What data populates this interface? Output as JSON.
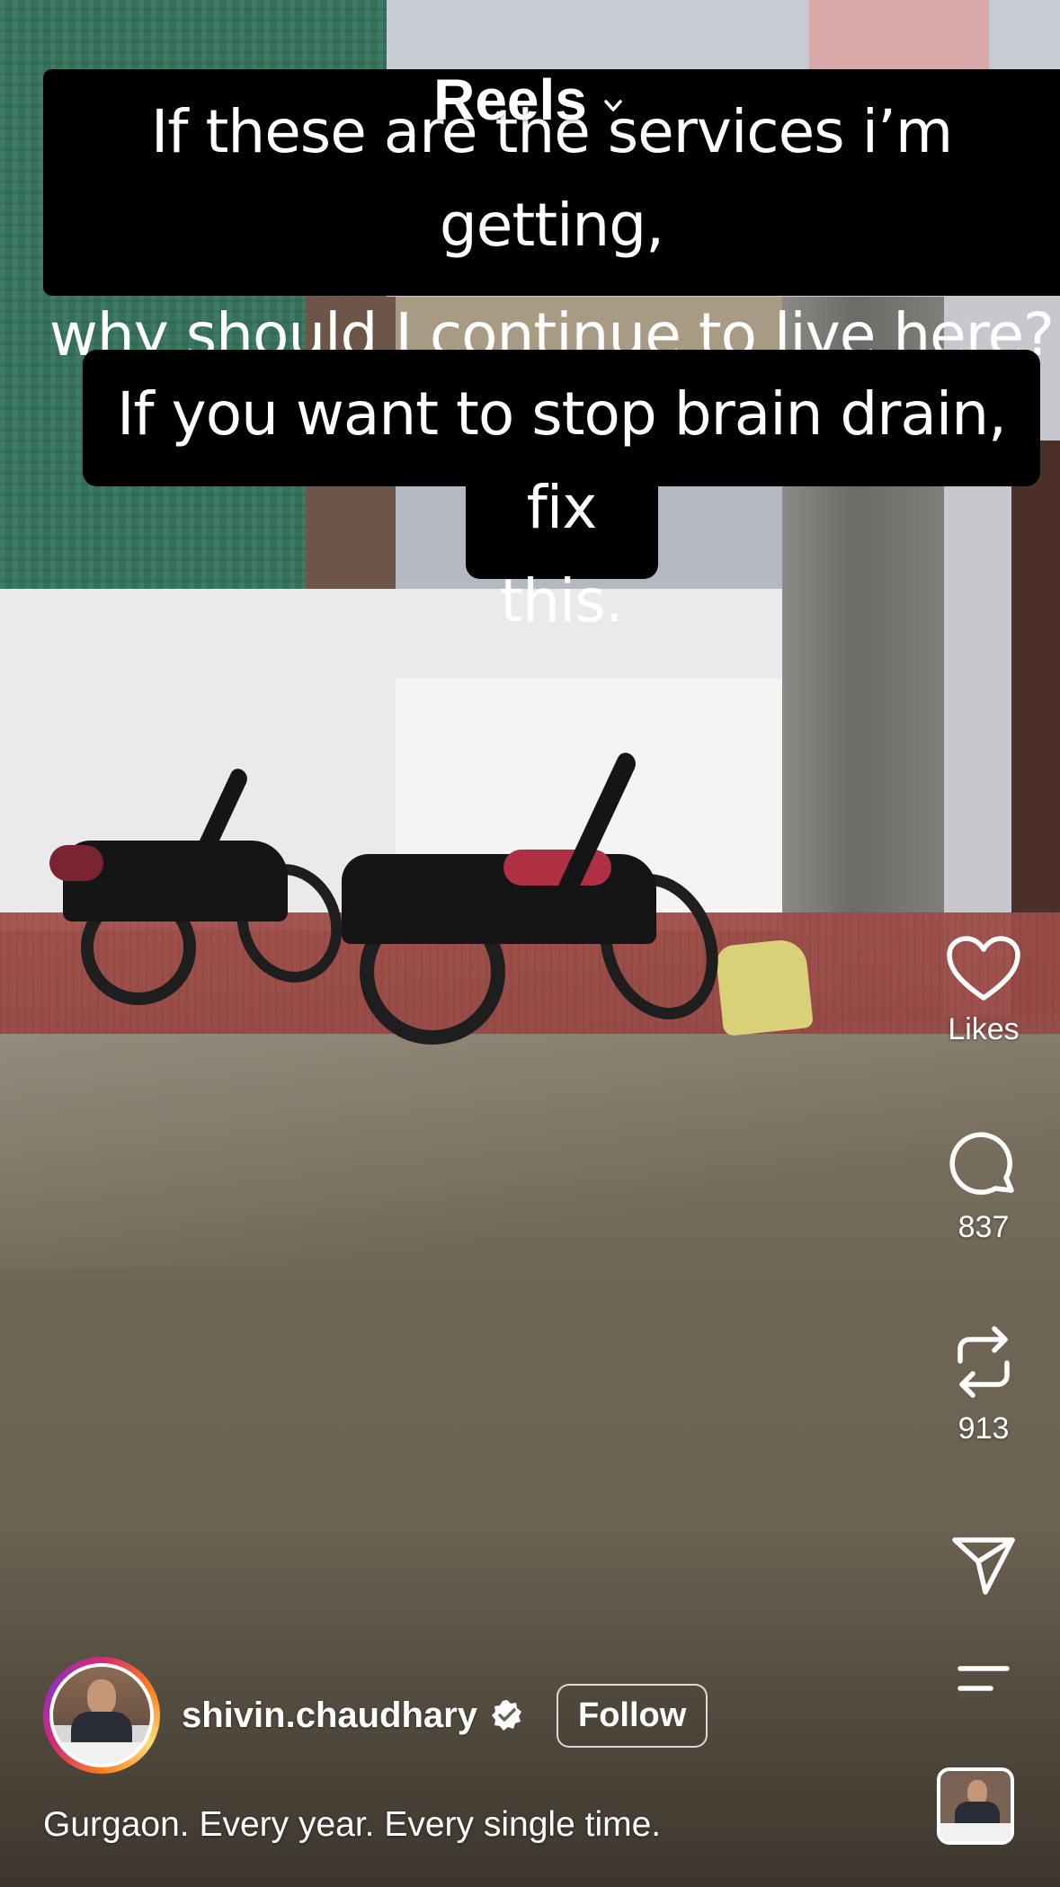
{
  "header": {
    "title": "Reels",
    "dropdown_icon": "chevron-down-icon"
  },
  "captions": {
    "line1": "If these are the services i’m getting,",
    "line2": "why should I continue to live here?",
    "line3": "If you want to stop brain drain, fix",
    "line4": "this."
  },
  "actions": {
    "like": {
      "icon": "heart-icon",
      "label": "Likes"
    },
    "comment": {
      "icon": "comment-icon",
      "count": "837"
    },
    "repost": {
      "icon": "repost-icon",
      "count": "913"
    },
    "share": {
      "icon": "send-icon"
    },
    "more": {
      "icon": "menu-icon"
    }
  },
  "author": {
    "username": "shivin.chaudhary",
    "verified_icon": "verified-badge-icon",
    "follow_label": "Follow"
  },
  "description": "Gurgaon. Every year. Every single time.",
  "colors": {
    "caption_bg": "#000000",
    "text": "#ffffff",
    "story_ring_start": "#d62976",
    "story_ring_end": "#feda75"
  }
}
